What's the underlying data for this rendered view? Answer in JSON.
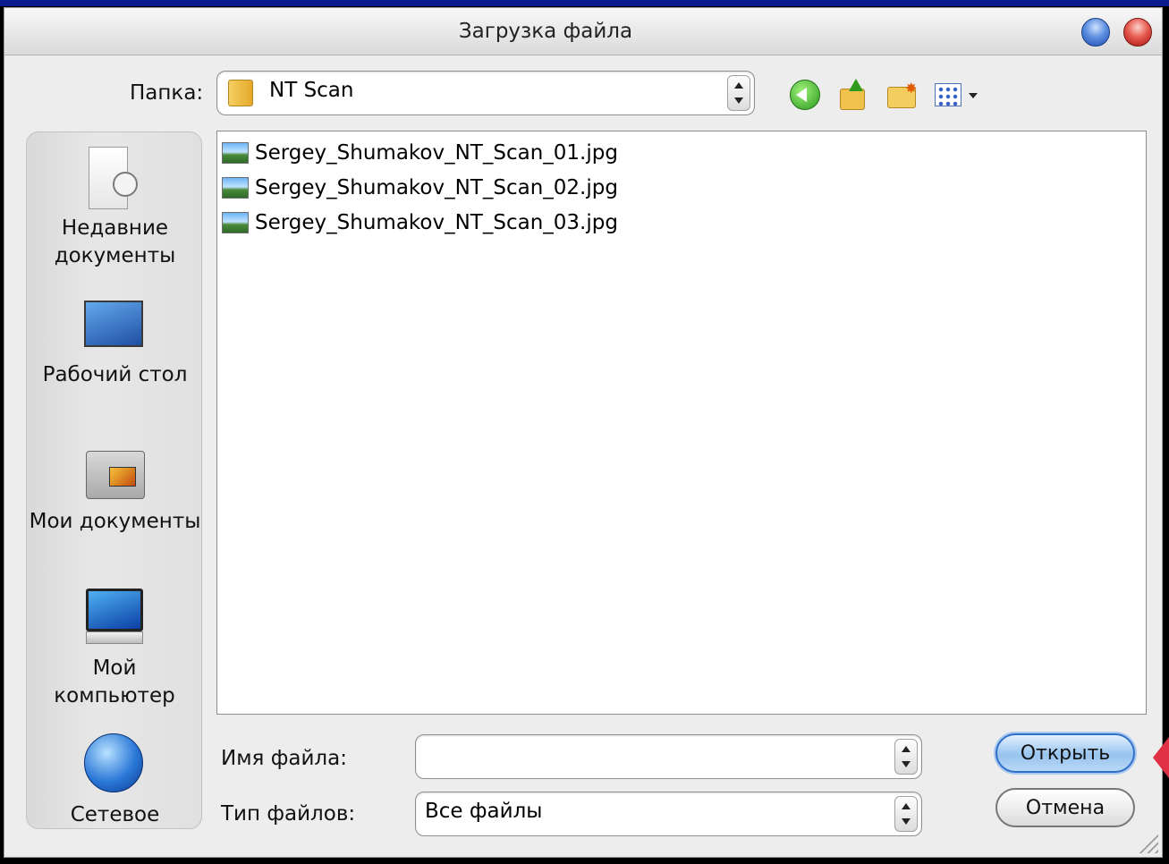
{
  "window": {
    "title": "Загрузка файла"
  },
  "toolbar": {
    "folder_label": "Папка:",
    "current_folder": "NT Scan",
    "buttons": [
      {
        "name": "back",
        "icon": "back-arrow-icon"
      },
      {
        "name": "up",
        "icon": "up-folder-icon"
      },
      {
        "name": "new_folder",
        "icon": "new-folder-icon"
      },
      {
        "name": "views",
        "icon": "views-menu-icon"
      }
    ]
  },
  "places": [
    {
      "label": "Недавние документы",
      "icon": "recent-documents-icon"
    },
    {
      "label": "Рабочий стол",
      "icon": "desktop-icon"
    },
    {
      "label": "Мои документы",
      "icon": "my-documents-icon"
    },
    {
      "label": "Мой компьютер",
      "icon": "my-computer-icon"
    },
    {
      "label": "Сетевое",
      "icon": "network-icon"
    }
  ],
  "files": [
    {
      "name": "Sergey_Shumakov_NT_Scan_01.jpg",
      "icon": "image-file-icon"
    },
    {
      "name": "Sergey_Shumakov_NT_Scan_02.jpg",
      "icon": "image-file-icon"
    },
    {
      "name": "Sergey_Shumakov_NT_Scan_03.jpg",
      "icon": "image-file-icon"
    }
  ],
  "form": {
    "filename_label": "Имя файла:",
    "filename_value": "",
    "filetype_label": "Тип файлов:",
    "filetype_value": "Все файлы"
  },
  "buttons": {
    "open": "Открыть",
    "cancel": "Отмена"
  },
  "colors": {
    "open_button_border": "#2f6fc8",
    "pointer_marker": "#e03244",
    "top_line": "#0a1a8c"
  }
}
